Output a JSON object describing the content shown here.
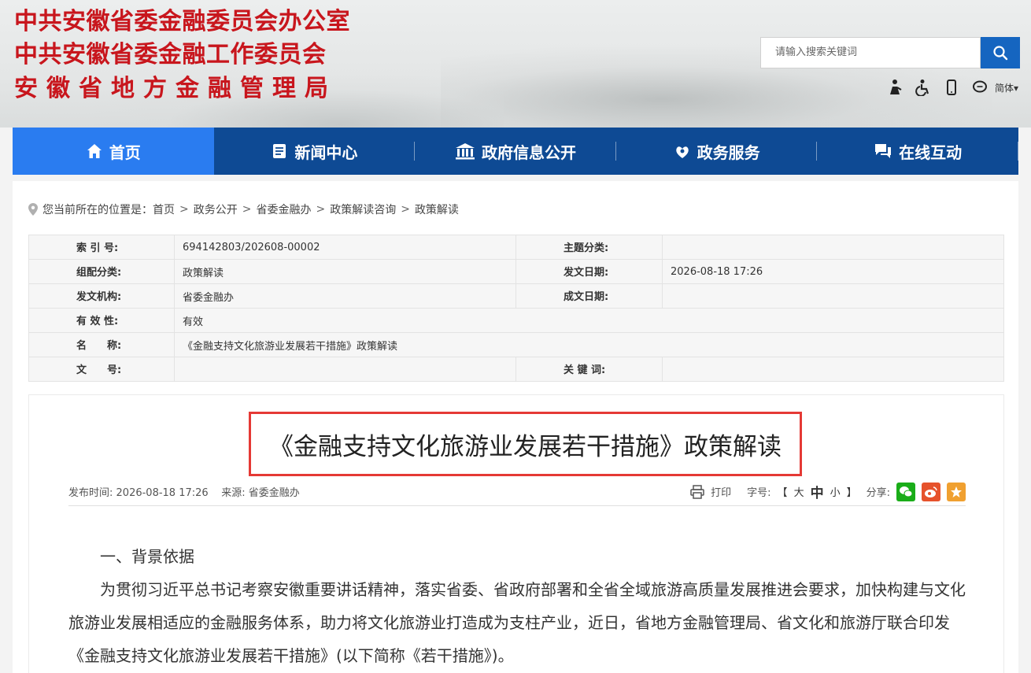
{
  "header": {
    "org_lines": [
      "中共安徽省委金融委员会办公室",
      "中共安徽省委金融工作委员会",
      "安徽省地方金融管理局"
    ],
    "search_placeholder": "请输入搜索关键词",
    "tools": [
      "elder-care-icon",
      "accessibility-icon",
      "mobile-icon",
      "wechat-icon"
    ],
    "lang_label": "简体",
    "lang_caret": "▾"
  },
  "nav": {
    "items": [
      {
        "label": "首页",
        "icon": "home-icon",
        "active": true
      },
      {
        "label": "新闻中心",
        "icon": "news-icon"
      },
      {
        "label": "政府信息公开",
        "icon": "government-icon"
      },
      {
        "label": "政务服务",
        "icon": "service-icon"
      },
      {
        "label": "在线互动",
        "icon": "chat-icon"
      }
    ],
    "colors": {
      "bg": "#0e4a94",
      "active": "#2a7cf0"
    }
  },
  "breadcrumb": {
    "prefix": "您当前所在的位置是：",
    "items": [
      "首页",
      "政务公开",
      "省委金融办",
      "政策解读咨询",
      "政策解读"
    ],
    "separator": ">"
  },
  "meta": {
    "rows": [
      {
        "label1": "索 引 号:",
        "value1": "694142803/202608-00002",
        "label2": "主题分类:",
        "value2": ""
      },
      {
        "label1": "组配分类:",
        "value1": "政策解读",
        "label2": "发文日期:",
        "value2": "2026-08-18 17:26"
      },
      {
        "label1": "发文机构:",
        "value1": "省委金融办",
        "label2": "成文日期:",
        "value2": ""
      },
      {
        "label1": "有 效 性:",
        "value1": "有效"
      },
      {
        "label1": "名　　称:",
        "value1": "《金融支持文化旅游业发展若干措施》政策解读"
      },
      {
        "label1": "文　　号:",
        "value1": "",
        "label2": "关 键 词:",
        "value2": ""
      }
    ]
  },
  "article": {
    "title": "《金融支持文化旅游业发展若干措施》政策解读",
    "publish_label": "发布时间:",
    "publish_time": "2026-08-18 17:26",
    "source_label": "来源:",
    "source": "省委金融办",
    "print_label": "打印",
    "font_label": "字号:",
    "font_open": "【",
    "font_large": "大",
    "font_medium": "中",
    "font_small": "小",
    "font_close": "】",
    "share_label": "分享:",
    "share_colors": {
      "wechat": "#1aad19",
      "weibo": "#e6522c",
      "favorite": "#f0a030"
    },
    "heading": "一、背景依据",
    "paragraph": "为贯彻习近平总书记考察安徽重要讲话精神，落实省委、省政府部署和全省全域旅游高质量发展推进会要求，加快构建与文化旅游业发展相适应的金融服务体系，助力将文化旅游业打造成为支柱产业，近日，省地方金融管理局、省文化和旅游厅联合印发《金融支持文化旅游业发展若干措施》(以下简称《若干措施》)。"
  }
}
